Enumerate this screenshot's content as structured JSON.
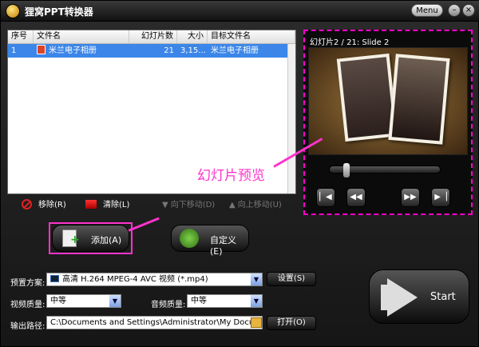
{
  "app": {
    "title": "狸窝PPT转换器",
    "menu_label": "Menu",
    "minimize": "–",
    "close": "×"
  },
  "list": {
    "columns": [
      "序号",
      "文件名",
      "幻灯片数",
      "大小",
      "目标文件名"
    ],
    "rows": [
      {
        "index": "1",
        "file": "米兰电子相册",
        "slides": "21",
        "size": "3,15...",
        "target": "米兰电子相册"
      }
    ]
  },
  "tools": {
    "remove": "移除(R)",
    "clear": "清除(L)",
    "move_down": "向下移动(D)",
    "move_up": "向上移动(U)"
  },
  "preview": {
    "label": "幻灯片2 / 21: Slide 2",
    "slider_position": 0.1
  },
  "annotation": "幻灯片预览",
  "buttons": {
    "add": "添加(A)",
    "custom": "自定义(E)",
    "start": "Start"
  },
  "settings": {
    "preset_label": "预置方案:",
    "preset_value": "高清 H.264 MPEG-4 AVC 视频 (*.mp4)",
    "settings_btn": "设置(S)",
    "video_quality_label": "视频质量:",
    "video_quality_value": "中等",
    "audio_quality_label": "音频质量:",
    "audio_quality_value": "中等",
    "output_label": "输出路径:",
    "output_value": "C:\\Documents and Settings\\Administrator\\My Documents\\Leawo\\Po",
    "open_btn": "打开(O)"
  },
  "colors": {
    "highlight": "#ff33cc",
    "selection": "#3b86e8"
  }
}
